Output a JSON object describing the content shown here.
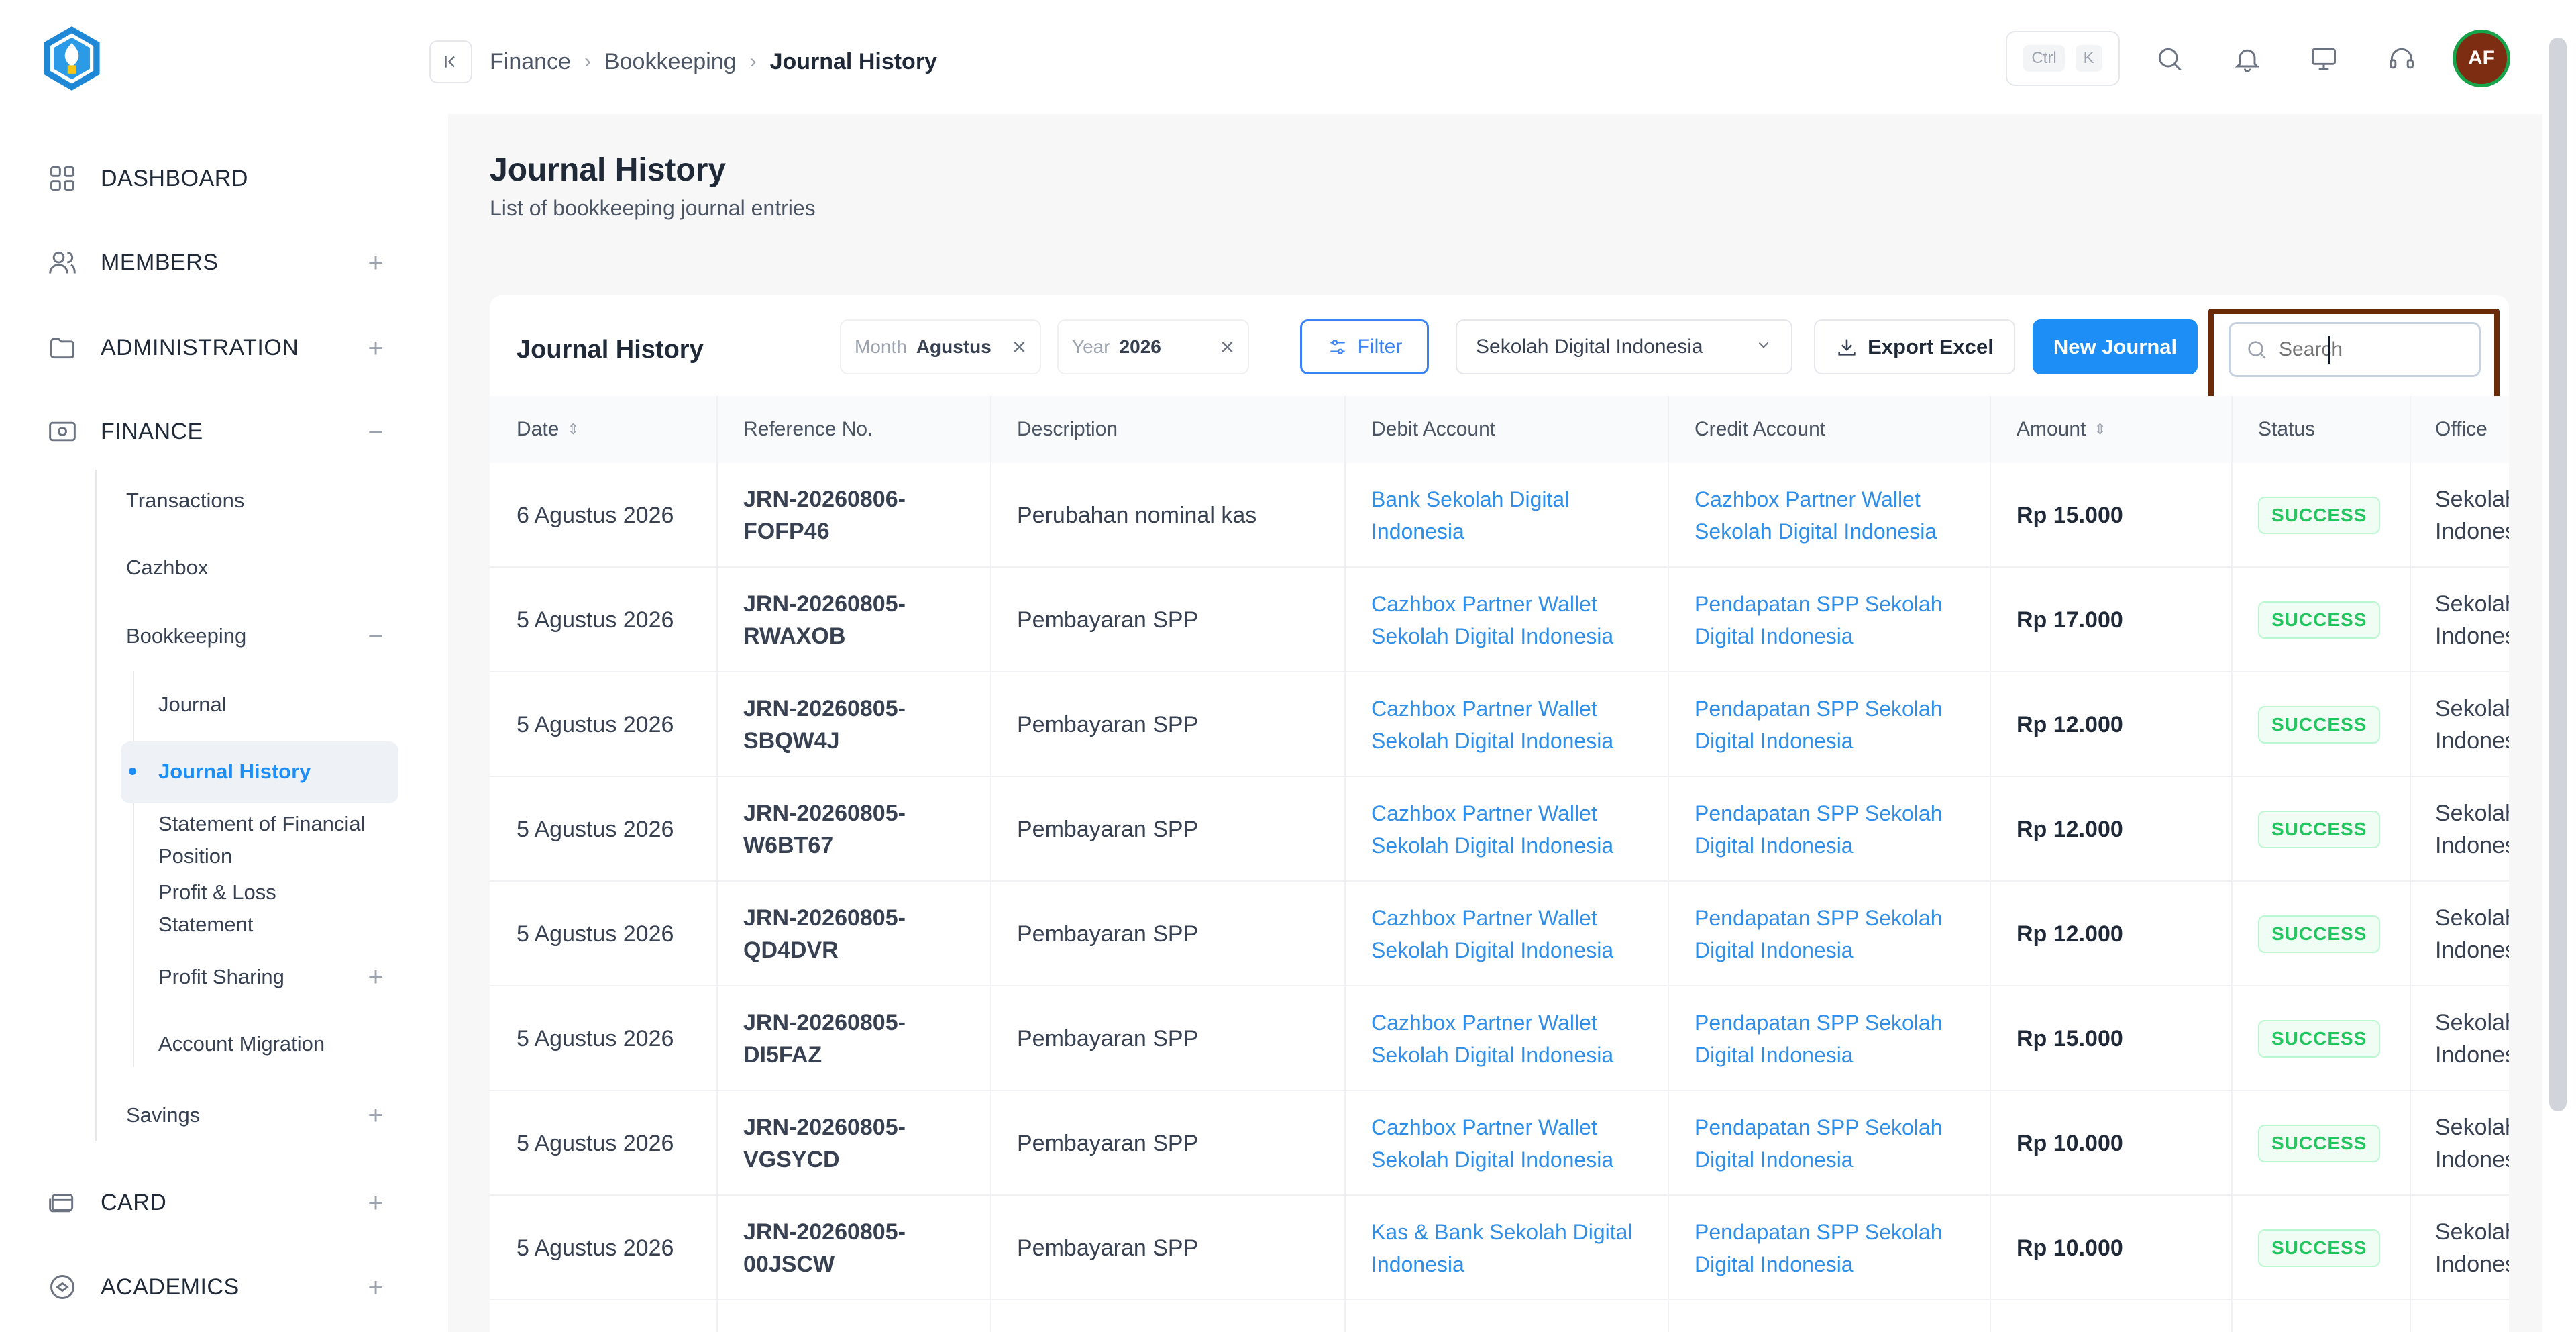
{
  "sidebar": {
    "top_items": [
      {
        "label": "DASHBOARD",
        "icon": "grid-icon"
      },
      {
        "label": "MEMBERS",
        "icon": "users-icon"
      },
      {
        "label": "ADMINISTRATION",
        "icon": "folder-icon"
      },
      {
        "label": "FINANCE",
        "icon": "money-icon"
      },
      {
        "label": "CARD",
        "icon": "card-icon"
      },
      {
        "label": "ACADEMICS",
        "icon": "academics-icon"
      }
    ],
    "finance_items": [
      "Transactions",
      "Cazhbox",
      "Bookkeeping",
      "Savings"
    ],
    "bookkeeping_items": [
      "Journal",
      "Journal History",
      "Statement of Financial Position",
      "Profit & Loss Statement",
      "Profit Sharing",
      "Account Migration"
    ]
  },
  "topbar": {
    "breadcrumb": [
      "Finance",
      "Bookkeeping",
      "Journal History"
    ],
    "shortcut": [
      "Ctrl",
      "K"
    ],
    "avatar_initials": "AF"
  },
  "page": {
    "title": "Journal History",
    "subtitle": "List of bookkeeping journal entries"
  },
  "toolbar": {
    "card_title": "Journal History",
    "month_label": "Month",
    "month_value": "Agustus",
    "year_label": "Year",
    "year_value": "2026",
    "filter_label": "Filter",
    "office_select": "Sekolah Digital Indonesia",
    "export_label": "Export Excel",
    "new_label": "New Journal",
    "search_placeholder": "Search"
  },
  "table": {
    "columns": [
      "Date",
      "Reference No.",
      "Description",
      "Debit Account",
      "Credit Account",
      "Amount",
      "Status",
      "Office"
    ],
    "rows": [
      {
        "date": "6 Agustus 2026",
        "ref": "JRN-20260806-FOFP46",
        "desc": "Perubahan nominal kas",
        "debit": "Bank Sekolah Digital Indonesia",
        "credit": "Cazhbox Partner Wallet Sekolah Digital Indonesia",
        "amount": "Rp 15.000",
        "status": "SUCCESS",
        "office": "Sekolah Indonesia"
      },
      {
        "date": "5 Agustus 2026",
        "ref": "JRN-20260805-RWAXOB",
        "desc": "Pembayaran SPP",
        "debit": "Cazhbox Partner Wallet Sekolah Digital Indonesia",
        "credit": "Pendapatan SPP Sekolah Digital Indonesia",
        "amount": "Rp 17.000",
        "status": "SUCCESS",
        "office": "Sekolah Indonesia"
      },
      {
        "date": "5 Agustus 2026",
        "ref": "JRN-20260805-SBQW4J",
        "desc": "Pembayaran SPP",
        "debit": "Cazhbox Partner Wallet Sekolah Digital Indonesia",
        "credit": "Pendapatan SPP Sekolah Digital Indonesia",
        "amount": "Rp 12.000",
        "status": "SUCCESS",
        "office": "Sekolah Indonesia"
      },
      {
        "date": "5 Agustus 2026",
        "ref": "JRN-20260805-W6BT67",
        "desc": "Pembayaran SPP",
        "debit": "Cazhbox Partner Wallet Sekolah Digital Indonesia",
        "credit": "Pendapatan SPP Sekolah Digital Indonesia",
        "amount": "Rp 12.000",
        "status": "SUCCESS",
        "office": "Sekolah Indonesia"
      },
      {
        "date": "5 Agustus 2026",
        "ref": "JRN-20260805-QD4DVR",
        "desc": "Pembayaran SPP",
        "debit": "Cazhbox Partner Wallet Sekolah Digital Indonesia",
        "credit": "Pendapatan SPP Sekolah Digital Indonesia",
        "amount": "Rp 12.000",
        "status": "SUCCESS",
        "office": "Sekolah Indonesia"
      },
      {
        "date": "5 Agustus 2026",
        "ref": "JRN-20260805-DI5FAZ",
        "desc": "Pembayaran SPP",
        "debit": "Cazhbox Partner Wallet Sekolah Digital Indonesia",
        "credit": "Pendapatan SPP Sekolah Digital Indonesia",
        "amount": "Rp 15.000",
        "status": "SUCCESS",
        "office": "Sekolah Indonesia"
      },
      {
        "date": "5 Agustus 2026",
        "ref": "JRN-20260805-VGSYCD",
        "desc": "Pembayaran SPP",
        "debit": "Cazhbox Partner Wallet Sekolah Digital Indonesia",
        "credit": "Pendapatan SPP Sekolah Digital Indonesia",
        "amount": "Rp 10.000",
        "status": "SUCCESS",
        "office": "Sekolah Indonesia"
      },
      {
        "date": "5 Agustus 2026",
        "ref": "JRN-20260805-00JSCW",
        "desc": "Pembayaran SPP",
        "debit": "Kas & Bank Sekolah Digital Indonesia",
        "credit": "Pendapatan SPP Sekolah Digital Indonesia",
        "amount": "Rp 10.000",
        "status": "SUCCESS",
        "office": "Sekolah Indonesia"
      }
    ]
  },
  "colors": {
    "accent": "#1d8ef5",
    "link": "#2f8fe8",
    "success": "#22c55e",
    "highlight_border": "#6b2a06"
  }
}
